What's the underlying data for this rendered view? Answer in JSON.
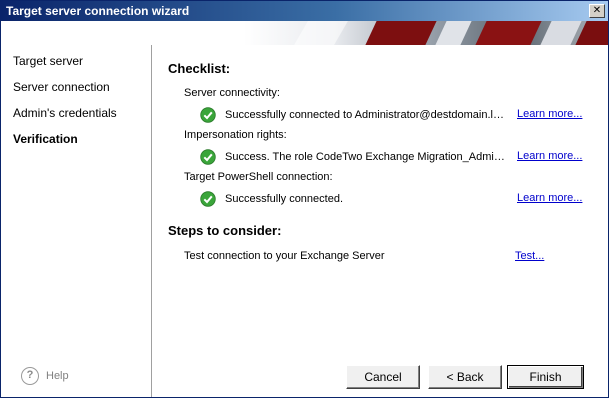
{
  "window": {
    "title": "Target server connection wizard",
    "close_glyph": "✕"
  },
  "sidebar": {
    "items": [
      {
        "label": "Target server",
        "active": false
      },
      {
        "label": "Server connection",
        "active": false
      },
      {
        "label": "Admin's credentials",
        "active": false
      },
      {
        "label": "Verification",
        "active": true
      }
    ],
    "help_label": "Help",
    "help_icon": "?"
  },
  "checklist": {
    "heading": "Checklist:",
    "sections": [
      {
        "label": "Server connectivity:",
        "status": "Successfully connected to Administrator@destdomain.lan.",
        "link": "Learn more..."
      },
      {
        "label": "Impersonation rights:",
        "status": "Success. The role CodeTwo Exchange Migration_Administrator is assigned.",
        "link": "Learn more..."
      },
      {
        "label": "Target PowerShell connection:",
        "status": "Successfully connected.",
        "link": "Learn more..."
      }
    ]
  },
  "steps": {
    "heading": "Steps to consider:",
    "items": [
      {
        "label": "Test connection to your Exchange Server",
        "link": "Test..."
      }
    ]
  },
  "buttons": {
    "cancel": "Cancel",
    "back": "< Back",
    "finish": "Finish"
  },
  "colors": {
    "link": "#0000cc",
    "ok_green": "#3aa53a",
    "title_bar": "#0a246a"
  }
}
